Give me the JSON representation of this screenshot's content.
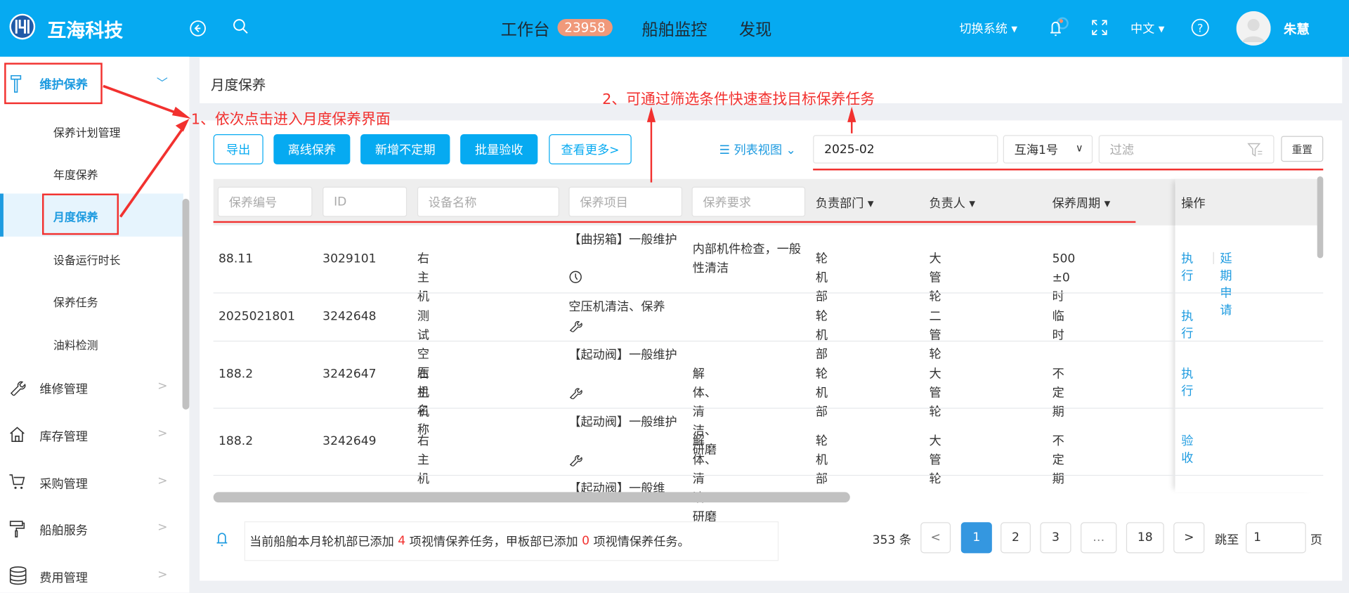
{
  "header": {
    "brand": "互海科技",
    "nav": [
      {
        "label": "工作台",
        "badge": "23958"
      },
      {
        "label": "船舶监控"
      },
      {
        "label": "发现"
      }
    ],
    "switch_system": "切换系统",
    "language": "中文",
    "user_name": "朱慧",
    "colors": {
      "bar": "#06aaf1",
      "badge": "#f0997a"
    }
  },
  "sidebar": {
    "groups": [
      {
        "label": "维护保养",
        "icon": "hammer-icon",
        "expanded": true,
        "items": [
          {
            "label": "保养计划管理"
          },
          {
            "label": "年度保养"
          },
          {
            "label": "月度保养",
            "active": true
          },
          {
            "label": "设备运行时长"
          },
          {
            "label": "保养任务"
          },
          {
            "label": "油料检测"
          }
        ]
      },
      {
        "label": "维修管理",
        "icon": "wrench-icon"
      },
      {
        "label": "库存管理",
        "icon": "home-icon"
      },
      {
        "label": "采购管理",
        "icon": "cart-icon"
      },
      {
        "label": "船舶服务",
        "icon": "paint-roller-icon"
      },
      {
        "label": "费用管理",
        "icon": "database-icon"
      }
    ]
  },
  "page": {
    "title": "月度保养"
  },
  "annotations": {
    "step1": "1、依次点击进入月度保养界面",
    "step2": "2、可通过筛选条件快速查找目标保养任务"
  },
  "toolbar": {
    "export": "导出",
    "offline": "离线保养",
    "add_irregular": "新增不定期",
    "batch_accept": "批量验收",
    "more": "查看更多>",
    "view_mode": "列表视图",
    "month": "2025-02",
    "ship": "互海1号",
    "filter_placeholder": "过滤",
    "reset": "重置"
  },
  "table": {
    "filters": {
      "code": "保养编号",
      "id": "ID",
      "device": "设备名称",
      "item": "保养项目",
      "requirement": "保养要求"
    },
    "headers": {
      "dept": "负责部门",
      "owner": "负责人",
      "cycle": "保养周期",
      "actions": "操作"
    },
    "rows": [
      {
        "code": "88.11",
        "id": "3029101",
        "device": "右主机",
        "item": "【曲拐箱】一般维护",
        "item_icon": "clock-icon",
        "requirement": "内部机件检查，一般性清洁",
        "dept": "轮机部",
        "owner": "大管轮",
        "cycle": "500 ±0时",
        "actions": [
          "执行",
          "延期申请"
        ]
      },
      {
        "code": "2025021801",
        "id": "3242648",
        "device": "测试空压机名称",
        "item": "空压机清洁、保养",
        "item_icon": "wrench-icon",
        "requirement": "",
        "dept": "轮机部",
        "owner": "二管轮",
        "cycle": "临时",
        "actions": [
          "执行"
        ]
      },
      {
        "code": "188.2",
        "id": "3242647",
        "device": "右主机",
        "item": "【起动阀】一般维护",
        "item_icon": "wrench-icon",
        "requirement": "解体、清洁、研磨",
        "dept": "轮机部",
        "owner": "大管轮",
        "cycle": "不定期",
        "actions": [
          "执行"
        ]
      },
      {
        "code": "188.2",
        "id": "3242649",
        "device": "右主机",
        "item": "【起动阀】一般维护",
        "item_icon": "wrench-icon",
        "requirement": "解体、清洁、研磨",
        "dept": "轮机部",
        "owner": "大管轮",
        "cycle": "不定期",
        "actions": [
          "验收"
        ]
      },
      {
        "item": "【起动阀】一般维"
      }
    ]
  },
  "notice": {
    "p1": "当前船舶本月轮机部已添加",
    "n1": "4",
    "p2": "项视情保养任务，甲板部已添加",
    "n2": "0",
    "p3": "项视情保养任务。"
  },
  "pagination": {
    "total": "353 条",
    "prev": "<",
    "pages": [
      "1",
      "2",
      "3",
      "…",
      "18"
    ],
    "current": "1",
    "next": ">",
    "jump_label": "跳至",
    "jump_value": "1",
    "page_unit": "页"
  }
}
